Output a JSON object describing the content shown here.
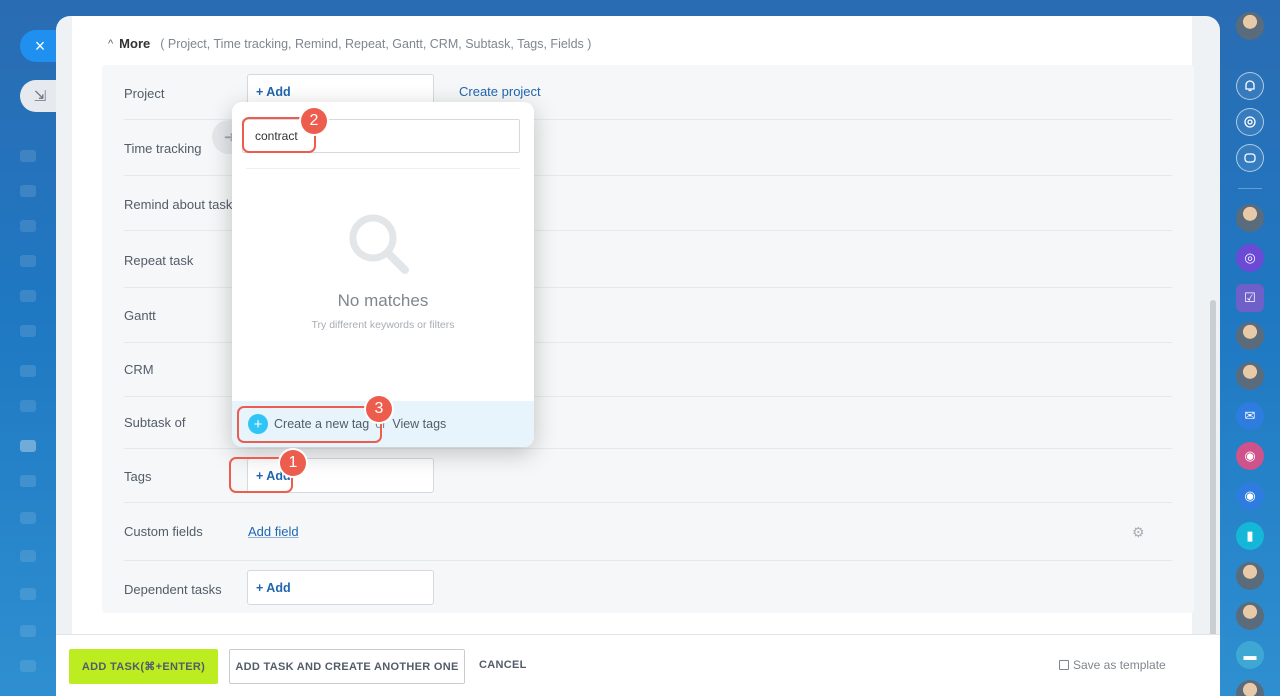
{
  "panel": {
    "more_label": "More",
    "more_list": "( Project,  Time tracking,  Remind,  Repeat,  Gantt,  CRM,  Subtask,  Tags,  Fields )"
  },
  "fields": {
    "project": {
      "label": "Project",
      "add": "+ Add",
      "link": "Create project"
    },
    "time_tracking": {
      "label": "Time tracking"
    },
    "remind": {
      "label": "Remind about task"
    },
    "repeat": {
      "label": "Repeat task"
    },
    "gantt": {
      "label": "Gantt"
    },
    "crm": {
      "label": "CRM"
    },
    "subtask": {
      "label": "Subtask of"
    },
    "tags": {
      "label": "Tags",
      "add": "+ Add"
    },
    "custom": {
      "label": "Custom fields",
      "link": "Add field"
    },
    "dependent": {
      "label": "Dependent tasks",
      "add": "+ Add"
    }
  },
  "popup": {
    "search_value": "contract",
    "empty_title": "No matches",
    "empty_hint": "Try different keywords or filters",
    "create_label": "Create a new tag",
    "or_label": "or",
    "view_label": "View tags"
  },
  "callouts": [
    "1",
    "2",
    "3"
  ],
  "bottom": {
    "primary": "ADD TASK(⌘+ENTER)",
    "secondary": "ADD TASK AND CREATE ANOTHER ONE",
    "cancel": "CANCEL",
    "save_template": "Save as template"
  },
  "controls": {
    "close_icon": "×",
    "minimize_icon": "⇲"
  },
  "colors": {
    "accent": "#2067b0",
    "callout": "#ec5d4e",
    "primary_button": "#bbed21"
  }
}
